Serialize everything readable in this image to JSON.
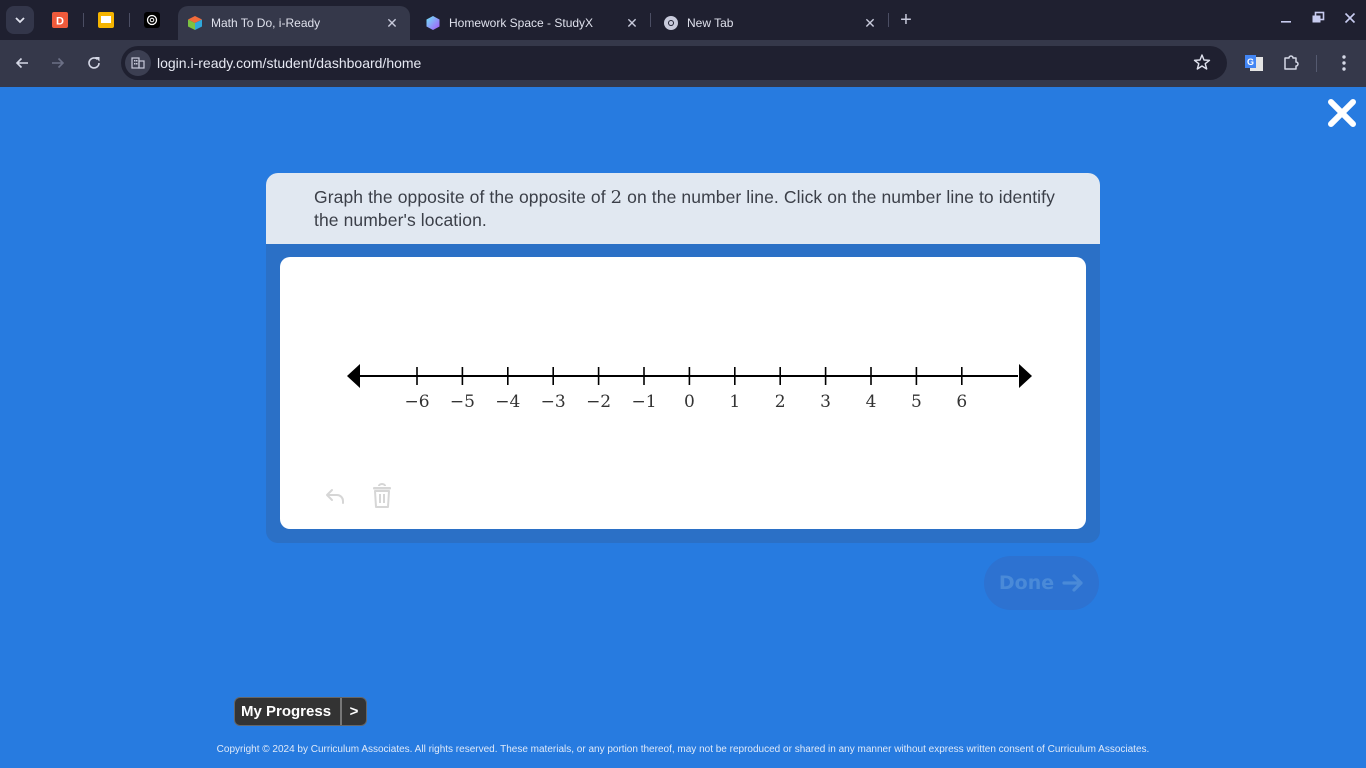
{
  "browser": {
    "tabs": [
      {
        "title": "",
        "favicon": "d-red-icon",
        "pinned": true
      },
      {
        "title": "",
        "favicon": "slides-yellow-icon",
        "pinned": true
      },
      {
        "title": "",
        "favicon": "openai-icon",
        "pinned": true
      },
      {
        "title": "Math To Do, i-Ready",
        "favicon": "iready-cube-icon",
        "active": true
      },
      {
        "title": "Homework Space - StudyX",
        "favicon": "studyx-cube-icon"
      },
      {
        "title": "New Tab",
        "favicon": "chrome-icon"
      }
    ],
    "new_tab_symbol": "+",
    "url": "login.i-ready.com/student/dashboard/home"
  },
  "lesson": {
    "prompt_before": "Graph the opposite of the opposite of ",
    "prompt_math": "2",
    "prompt_after": " on the number line. Click on the number line to identify the number's location.",
    "done_label": "Done",
    "done_enabled": false,
    "undo_enabled": false,
    "delete_enabled": false
  },
  "number_line": {
    "min": -6,
    "max": 6,
    "step": 1,
    "labels": [
      "−6",
      "−5",
      "−4",
      "−3",
      "−2",
      "−1",
      "0",
      "1",
      "2",
      "3",
      "4",
      "5",
      "6"
    ],
    "selected_point": null
  },
  "footer": {
    "my_progress_label": "My Progress",
    "my_progress_arrow": ">",
    "copyright": "Copyright © 2024 by Curriculum Associates. All rights reserved. These materials, or any portion thereof, may not be reproduced or shared in any manner without express written consent of Curriculum Associates."
  },
  "colors": {
    "page_bg": "#277be0",
    "prompt_bg": "#e1e8f1",
    "card_frame": "#2b70c6",
    "done_disabled_bg": "#2d72d1"
  }
}
